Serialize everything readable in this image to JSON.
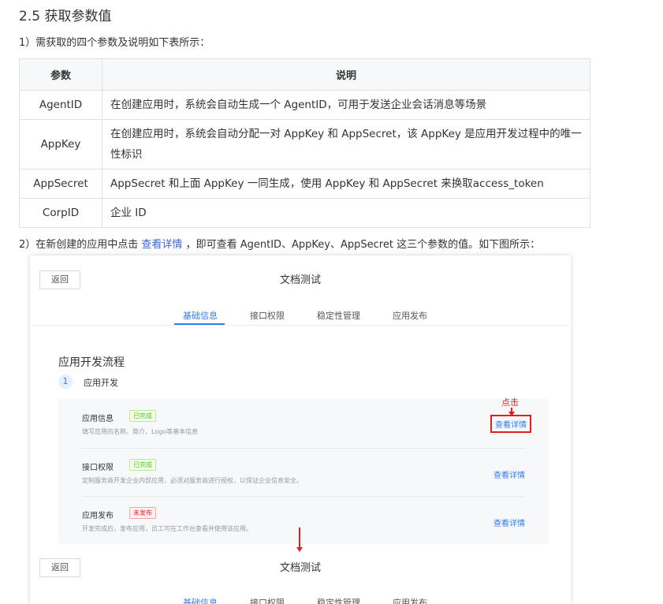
{
  "heading": "2.5 获取参数值",
  "intro": "1）需获取的四个参数及说明如下表所示：",
  "table": {
    "headers": [
      "参数",
      "说明"
    ],
    "rows": [
      {
        "name": "AgentID",
        "desc": "在创建应用时，系统会自动生成一个 AgentID，可用于发送企业会话消息等场景"
      },
      {
        "name": "AppKey",
        "desc": "在创建应用时，系统会自动分配一对 AppKey 和 AppSecret，该 AppKey 是应用开发过程中的唯一性标识"
      },
      {
        "name": "AppSecret",
        "desc": "AppSecret 和上面 AppKey 一同生成，使用 AppKey 和 AppSecret 来换取access_token"
      },
      {
        "name": "CorpID",
        "desc": "企业 ID"
      }
    ]
  },
  "step2": {
    "prefix": "2）在新创建的应用中点击",
    "link": "查看详情",
    "suffix": "，即可查看 AgentID、AppKey、AppSecret 这三个参数的值。如下图所示："
  },
  "shot": {
    "back": "返回",
    "title": "文档测试",
    "tabs": [
      "基础信息",
      "接口权限",
      "稳定性管理",
      "应用发布"
    ],
    "flow_title": "应用开发流程",
    "step_num": "1",
    "step_label": "应用开发",
    "click_note": "点击",
    "rows": [
      {
        "title": "应用信息",
        "status": "已完成",
        "desc": "填写应用的名称、简介、Logo等基本信息",
        "action": "查看详情"
      },
      {
        "title": "接口权限",
        "status": "已完成",
        "desc": "定制服务商开发企业内部应用，必须对服务商进行授权，以保证企业信息安全。",
        "action": "查看详情"
      },
      {
        "title": "应用发布",
        "status": "未发布",
        "desc": "开发完成后，发布应用，员工可在工作台查看并使用该应用。",
        "action": "查看详情"
      }
    ]
  }
}
